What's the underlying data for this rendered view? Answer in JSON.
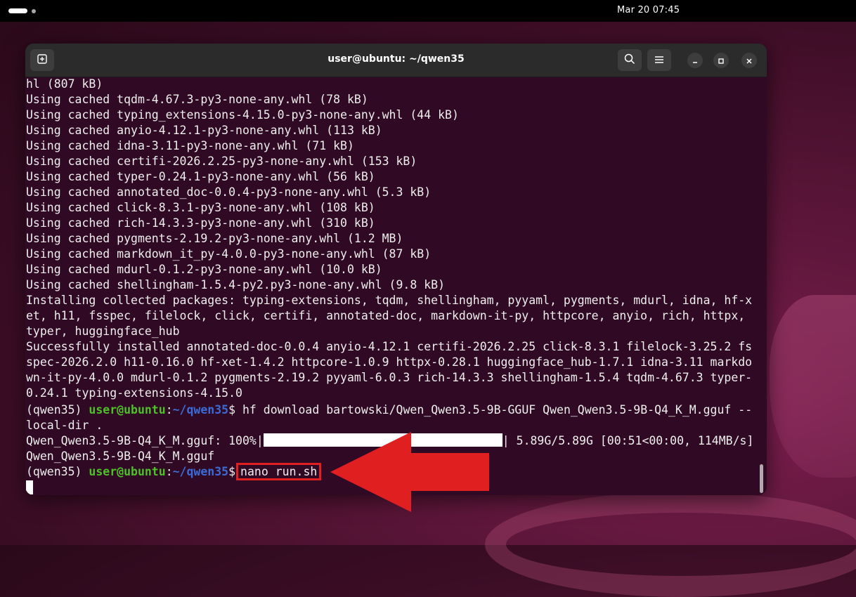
{
  "topbar": {
    "datetime": "Mar 20  07:45"
  },
  "window": {
    "title": "user@ubuntu: ~/qwen35"
  },
  "terminal": {
    "lines": [
      "hl (807 kB)",
      "Using cached tqdm-4.67.3-py3-none-any.whl (78 kB)",
      "Using cached typing_extensions-4.15.0-py3-none-any.whl (44 kB)",
      "Using cached anyio-4.12.1-py3-none-any.whl (113 kB)",
      "Using cached idna-3.11-py3-none-any.whl (71 kB)",
      "Using cached certifi-2026.2.25-py3-none-any.whl (153 kB)",
      "Using cached typer-0.24.1-py3-none-any.whl (56 kB)",
      "Using cached annotated_doc-0.0.4-py3-none-any.whl (5.3 kB)",
      "Using cached click-8.3.1-py3-none-any.whl (108 kB)",
      "Using cached rich-14.3.3-py3-none-any.whl (310 kB)",
      "Using cached pygments-2.19.2-py3-none-any.whl (1.2 MB)",
      "Using cached markdown_it_py-4.0.0-py3-none-any.whl (87 kB)",
      "Using cached mdurl-0.1.2-py3-none-any.whl (10.0 kB)",
      "Using cached shellingham-1.5.4-py2.py3-none-any.whl (9.8 kB)",
      "Installing collected packages: typing-extensions, tqdm, shellingham, pyyaml, pygments, mdurl, idna, hf-x",
      "et, h11, fsspec, filelock, click, certifi, annotated-doc, markdown-it-py, httpcore, anyio, rich, httpx,",
      "typer, huggingface_hub",
      "Successfully installed annotated-doc-0.0.4 anyio-4.12.1 certifi-2026.2.25 click-8.3.1 filelock-3.25.2 fs",
      "spec-2026.2.0 h11-0.16.0 hf-xet-1.4.2 httpcore-1.0.9 httpx-0.28.1 huggingface_hub-1.7.1 idna-3.11 markdo",
      "wn-it-py-4.0.0 mdurl-0.1.2 pygments-2.19.2 pyyaml-6.0.3 rich-14.3.3 shellingham-1.5.4 tqdm-4.67.3 typer-",
      "0.24.1 typing-extensions-4.15.0"
    ],
    "prompt1": {
      "env": "(qwen35) ",
      "user": "user@ubuntu",
      "colon": ":",
      "path": "~/qwen35",
      "dollar": "$ ",
      "command": "hf download bartowski/Qwen_Qwen3.5-9B-GGUF Qwen_Qwen3.5-9B-Q4_K_M.gguf --"
    },
    "prompt1_cont": "local-dir .",
    "progress": {
      "prefix": "Qwen_Qwen3.5-9B-Q4_K_M.gguf: 100%|",
      "suffix": "| 5.89G/5.89G [00:51<00:00, 114MB/s]",
      "fraction": 1.0
    },
    "result_line": "Qwen_Qwen3.5-9B-Q4_K_M.gguf",
    "prompt2": {
      "env": "(qwen35) ",
      "user": "user@ubuntu",
      "colon": ":",
      "path": "~/qwen35",
      "dollar": "$",
      "command": "nano run.sh"
    }
  },
  "icons": {
    "new_tab": "new-tab-icon",
    "search": "search-icon",
    "menu": "hamburger-menu-icon",
    "minimize": "minimize-icon",
    "maximize": "maximize-icon",
    "close": "close-icon",
    "annotation": "red-arrow-icon"
  },
  "colors": {
    "terminal_bg": "#300a24",
    "prompt_user": "#4ec02a",
    "prompt_path": "#3a6bd6",
    "annotation": "#e02020"
  }
}
